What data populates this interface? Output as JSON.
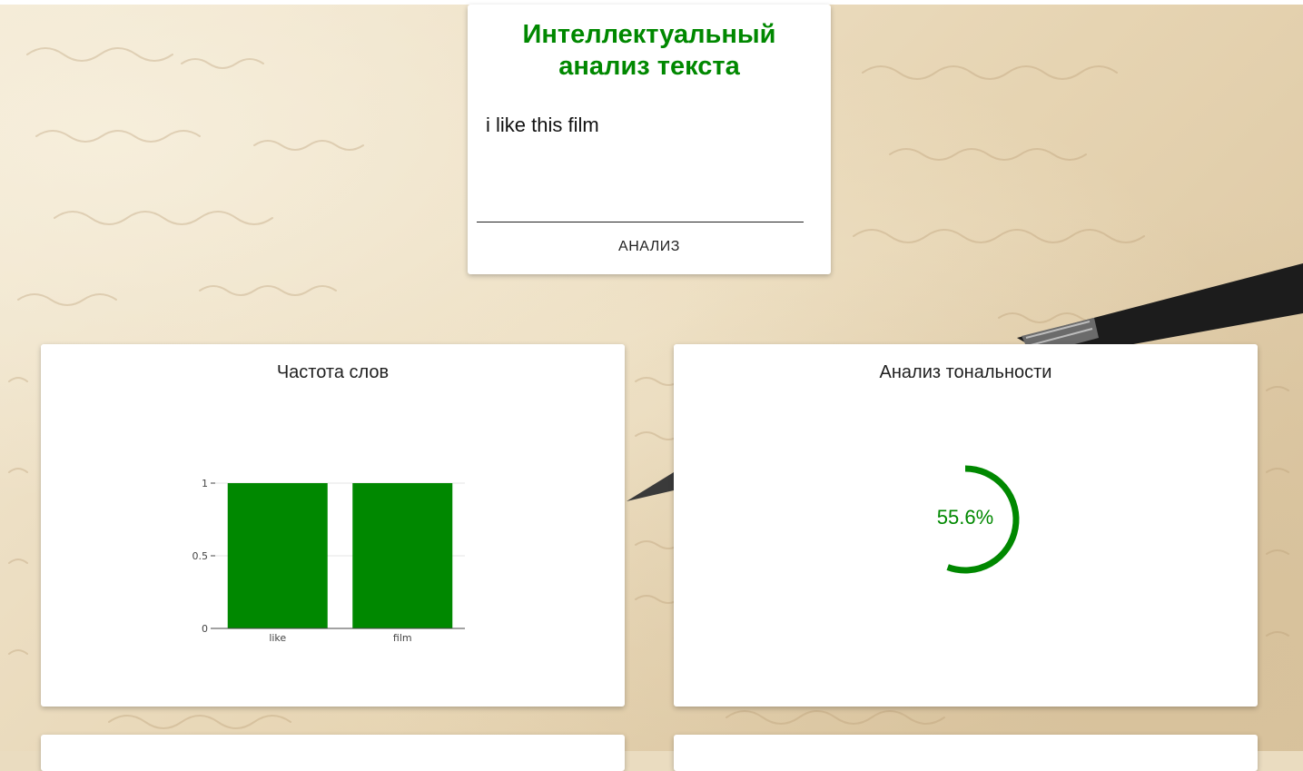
{
  "app": {
    "title_line1": "Интеллектуальный",
    "title_line2": "анализ текста",
    "input_value": "i like this film",
    "analyze_label": "АНАЛИЗ"
  },
  "colors": {
    "accent": "#008800",
    "card": "#ffffff",
    "text": "#1f1f1f"
  },
  "panels": {
    "frequency": {
      "title": "Частота слов"
    },
    "tonality": {
      "title": "Анализ тональности",
      "value_label": "55.6%",
      "value_fraction": 0.556
    }
  },
  "chart_data": {
    "type": "bar",
    "categories": [
      "like",
      "film"
    ],
    "values": [
      1,
      1
    ],
    "ylim": [
      0,
      1
    ],
    "yticks": [
      0,
      0.5,
      1
    ],
    "ytick_labels": [
      "0",
      "0.5",
      "1"
    ],
    "grid": true,
    "color": "#008800"
  }
}
